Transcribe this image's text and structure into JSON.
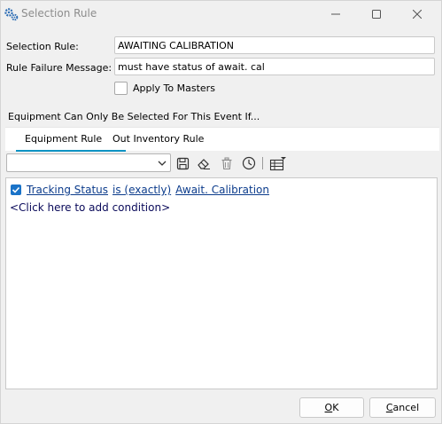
{
  "window": {
    "title": "Selection Rule"
  },
  "form": {
    "selection_rule_label": "Selection Rule:",
    "selection_rule_value": "AWAITING CALIBRATION",
    "failure_message_label": "Rule Failure Message:",
    "failure_message_value": "must have status of await. cal",
    "apply_to_masters_label": "Apply To Masters",
    "apply_to_masters_checked": false
  },
  "section_note": "Equipment Can Only Be Selected For This Event If...",
  "tabs": [
    {
      "label": "Equipment Rule",
      "active": true
    },
    {
      "label": "Out Inventory Rule",
      "active": false
    }
  ],
  "toolbar": {
    "combo_value": "",
    "icons": [
      "save-icon",
      "eraser-icon",
      "trash-icon",
      "clock-icon",
      "table-options-icon"
    ]
  },
  "rule": {
    "condition_checked": true,
    "field": "Tracking Status",
    "operator": "is (exactly)",
    "value": "Await. Calibration",
    "add_condition": "<Click here to add condition>"
  },
  "buttons": {
    "ok_mnemonic": "O",
    "ok_rest": "K",
    "cancel_mnemonic": "C",
    "cancel_rest": "ancel"
  },
  "colors": {
    "accent": "#0f93c4",
    "link": "#0c3c8c",
    "checkbox_checked": "#1a73c8",
    "app_icon": "#2f6fb6"
  }
}
